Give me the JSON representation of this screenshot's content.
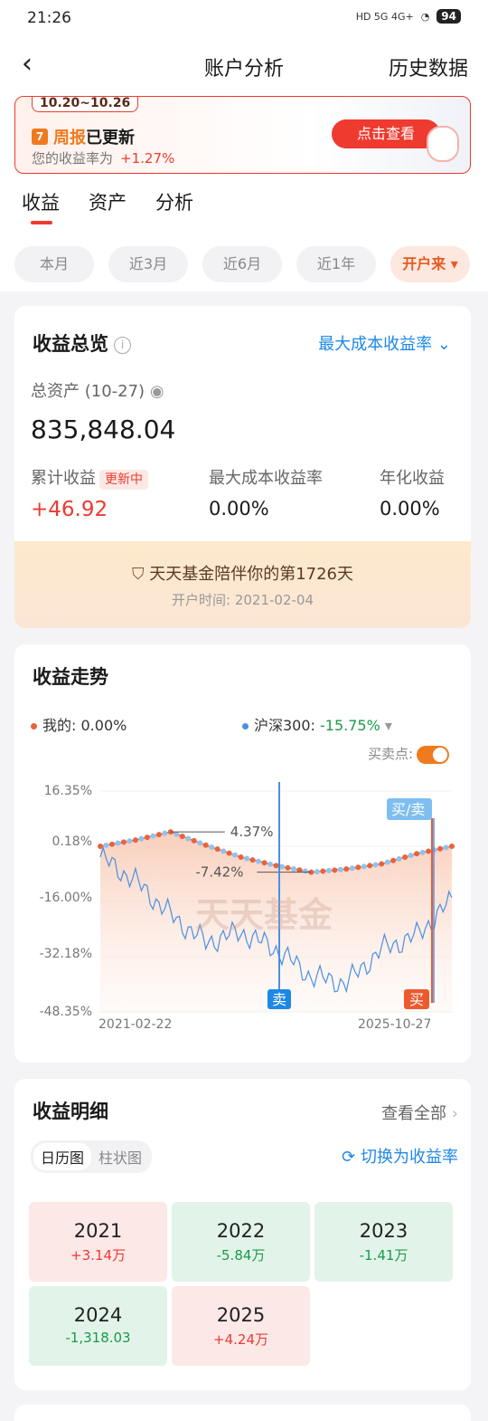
{
  "status": {
    "time": "21:26",
    "network": "HD 5G 4G+",
    "battery": "94"
  },
  "nav": {
    "back": "‹",
    "title": "账户分析",
    "right": "历史数据"
  },
  "banner": {
    "date": "10.20~10.26",
    "tag_a": "周报",
    "tag_b": "已更新",
    "sub": "您的收益率为",
    "rate": "+1.27%",
    "button": "点击查看"
  },
  "tabs": [
    {
      "label": "收益"
    },
    {
      "label": "资产"
    },
    {
      "label": "分析"
    }
  ],
  "periods": [
    {
      "label": "本月"
    },
    {
      "label": "近3月"
    },
    {
      "label": "近6月"
    },
    {
      "label": "近1年"
    },
    {
      "label": "开户来"
    }
  ],
  "overview": {
    "title": "收益总览",
    "switch": "最大成本收益率",
    "total_label": "总资产 (10-27)",
    "total_value": "835,848.04",
    "cum_label": "累计收益",
    "updating": "更新中",
    "cum_value": "+46.92",
    "max_rate_label": "最大成本收益率",
    "max_rate_value": "0.00%",
    "annual_label": "年化收益",
    "annual_value": "0.00%",
    "companion": "天天基金陪伴你的第1726天",
    "open_date": "开户时间: 2021-02-04"
  },
  "trend": {
    "title": "收益走势",
    "mine_label": "我的:",
    "mine_value": "0.00%",
    "index_label": "沪深300:",
    "index_value": "-15.75%",
    "trade_label": "买卖点:",
    "watermark": "天天基金",
    "buy_sell": "买/卖",
    "sell": "卖",
    "buy": "买",
    "peak_label": "4.37%",
    "low_label": "-7.42%",
    "colors": {
      "mine": "#e8643c",
      "index": "#4a90e2",
      "fill": "#f9c9b4"
    }
  },
  "chart_data": {
    "type": "line",
    "x": [
      "2021-02-22",
      "2025-10-27"
    ],
    "xlabel": "",
    "ylabel": "",
    "yticks": [
      "16.35%",
      "0.18%",
      "-16.00%",
      "-32.18%",
      "-48.35%"
    ],
    "ylim": [
      -48.35,
      16.35
    ],
    "series": [
      {
        "name": "我的",
        "values": [
          0.18,
          2.0,
          4.37,
          0.5,
          -3.0,
          -5.5,
          -7.42,
          -6.5,
          -5.0,
          -2.0,
          0.18
        ]
      },
      {
        "name": "沪深300",
        "values": [
          -3.0,
          -10.0,
          -20.0,
          -28.0,
          -25.0,
          -30.0,
          -38.0,
          -40.0,
          -30.0,
          -26.0,
          -15.75
        ]
      }
    ],
    "annotations": [
      "4.37%",
      "-7.42%",
      "买/卖",
      "卖",
      "买"
    ]
  },
  "detail": {
    "title": "收益明细",
    "view_all": "查看全部",
    "seg_cal": "日历图",
    "seg_bar": "柱状图",
    "toggle_rate": "切换为收益率",
    "years": [
      {
        "year": "2021",
        "value": "+3.14万"
      },
      {
        "year": "2022",
        "value": "-5.84万"
      },
      {
        "year": "2023",
        "value": "-1.41万"
      },
      {
        "year": "2024",
        "value": "-1,318.03"
      },
      {
        "year": "2025",
        "value": "+4.24万"
      }
    ]
  }
}
